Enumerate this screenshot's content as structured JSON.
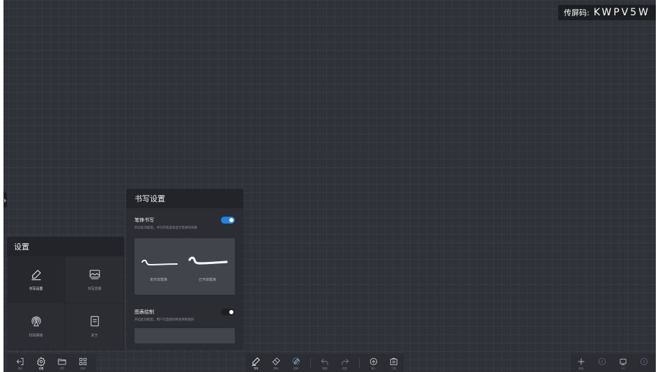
{
  "screen_code": {
    "label": "传屏码:",
    "value": "KWPV5W"
  },
  "settings_panel": {
    "title": "设置",
    "items": [
      {
        "label": "书写设置",
        "icon": "pen-icon",
        "active": true
      },
      {
        "label": "书写背景",
        "icon": "image-icon",
        "active": false
      },
      {
        "label": "扫码网络",
        "icon": "broadcast-icon",
        "active": false
      },
      {
        "label": "关于",
        "icon": "document-icon",
        "active": false
      }
    ]
  },
  "writing_panel": {
    "title": "书写设置",
    "stroke": {
      "title": "笔锋书写",
      "desc": "开启此功能后，书写的笔迹会显示笔锋的效果",
      "enabled": true,
      "caption_off": "未开启笔锋",
      "caption_on": "已开启笔锋"
    },
    "chart": {
      "title": "图表绘制",
      "desc": "开启此功能后，用户可直接绘制表格和图形",
      "enabled": false
    }
  },
  "toolbar_left": [
    {
      "name": "exit-button",
      "icon": "exit-icon",
      "label": "退出"
    },
    {
      "name": "settings-button",
      "icon": "gear-icon",
      "label": "设置",
      "active": true
    },
    {
      "name": "files-button",
      "icon": "folder-icon",
      "label": "文件"
    },
    {
      "name": "apps-button",
      "icon": "grid-icon",
      "label": "应用"
    }
  ],
  "toolbar_center": [
    {
      "name": "pen-button",
      "icon": "pen-icon",
      "label": "书写",
      "active": true
    },
    {
      "name": "eraser-button",
      "icon": "eraser-icon",
      "label": "擦除"
    },
    {
      "name": "select-button",
      "icon": "lasso-icon",
      "label": "选择"
    },
    {
      "name": "undo-button",
      "icon": "undo-icon",
      "label": "撤销"
    },
    {
      "name": "redo-button",
      "icon": "redo-icon",
      "label": "恢复"
    },
    {
      "name": "insert-button",
      "icon": "plus-circle-icon",
      "label": "插入"
    },
    {
      "name": "tools-button",
      "icon": "toolbox-icon",
      "label": "工具"
    }
  ],
  "toolbar_right": [
    {
      "name": "new-page-button",
      "icon": "plus-icon",
      "label": "新页"
    },
    {
      "name": "prev-page-button",
      "icon": "prev-icon",
      "label": ""
    },
    {
      "name": "pages-button",
      "icon": "pages-icon",
      "label": "1/1"
    },
    {
      "name": "next-page-button",
      "icon": "next-icon",
      "label": ""
    }
  ]
}
